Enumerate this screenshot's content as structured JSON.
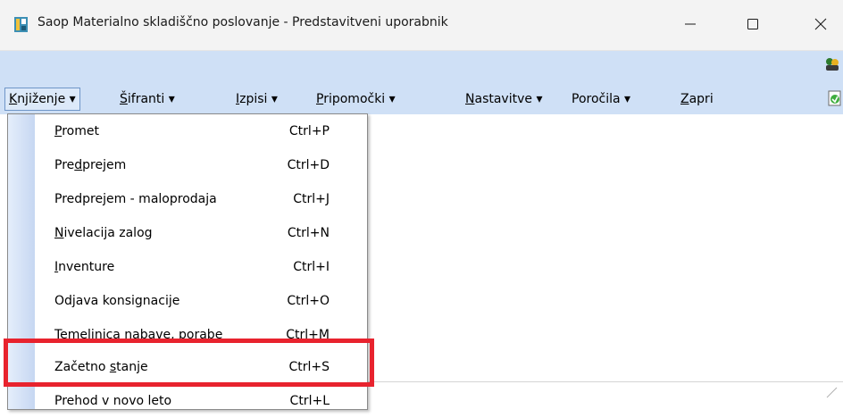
{
  "window": {
    "title": "Saop  Materialno skladiščno poslovanje - Predstavitveni uporabnik",
    "minimize_glyph": "—",
    "maximize_glyph": "☐",
    "close_glyph": "✕"
  },
  "menubar": {
    "items": [
      {
        "pre": "",
        "u": "K",
        "post": "njiženje ▾"
      },
      {
        "pre": "",
        "u": "Š",
        "post": "ifranti ▾"
      },
      {
        "pre": "",
        "u": "I",
        "post": "zpisi ▾"
      },
      {
        "pre": "",
        "u": "P",
        "post": "ripomočki ▾"
      },
      {
        "pre": "",
        "u": "N",
        "post": "astavitve ▾"
      },
      {
        "pre": "Poročila ▾",
        "u": "",
        "post": ""
      },
      {
        "pre": "",
        "u": "Z",
        "post": "apri"
      }
    ]
  },
  "dropdown": {
    "items": [
      {
        "pre": "",
        "u": "P",
        "post": "romet",
        "shortcut": "Ctrl+P"
      },
      {
        "pre": "Pre",
        "u": "d",
        "post": "prejem",
        "shortcut": "Ctrl+D"
      },
      {
        "pre": "Predprejem - maloprodaja",
        "u": "",
        "post": "",
        "shortcut": "Ctrl+J"
      },
      {
        "pre": "",
        "u": "N",
        "post": "ivelacija zalog",
        "shortcut": "Ctrl+N"
      },
      {
        "pre": "",
        "u": "I",
        "post": "nventure",
        "shortcut": "Ctrl+I"
      },
      {
        "pre": "Odjava konsignacije",
        "u": "",
        "post": "",
        "shortcut": "Ctrl+O"
      },
      {
        "pre": "Temeljnica nabave, porabe",
        "u": "",
        "post": "",
        "shortcut": "Ctrl+M"
      },
      {
        "pre": "Začetno ",
        "u": "s",
        "post": "tanje",
        "shortcut": "Ctrl+S"
      },
      {
        "pre": "Prehod v novo leto",
        "u": "",
        "post": "",
        "shortcut": "Ctrl+L"
      }
    ],
    "highlighted_index": 7
  },
  "colors": {
    "menubar_bg": "#cfe0f6",
    "highlight_border": "#e8232e",
    "gutter": "#c6d7f2"
  },
  "icons": {
    "app": "app-logo-icon",
    "tool1": "users-icon",
    "tool2": "refresh-document-icon"
  }
}
